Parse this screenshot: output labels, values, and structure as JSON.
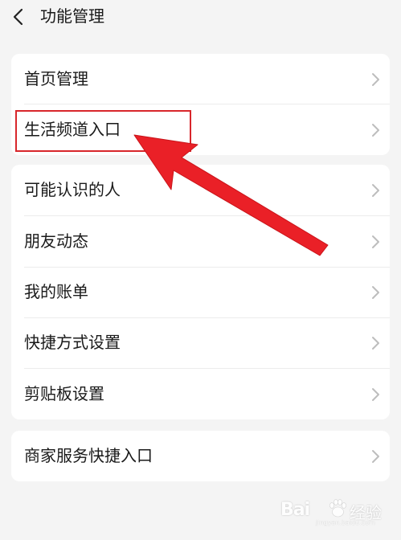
{
  "header": {
    "title": "功能管理",
    "back_icon": "chevron-left-icon"
  },
  "groups": [
    {
      "items": [
        {
          "label": "首页管理"
        },
        {
          "label": "生活频道入口",
          "highlighted": true
        }
      ]
    },
    {
      "items": [
        {
          "label": "可能认识的人"
        },
        {
          "label": "朋友动态"
        },
        {
          "label": "我的账单"
        },
        {
          "label": "快捷方式设置"
        },
        {
          "label": "剪贴板设置"
        }
      ]
    },
    {
      "items": [
        {
          "label": "商家服务快捷入口"
        }
      ]
    }
  ],
  "annotation": {
    "color": "#d8262b",
    "target": "生活频道入口"
  },
  "watermark": {
    "brand": "Bai",
    "text": "经验",
    "url": "jingyan.baidu.com"
  }
}
